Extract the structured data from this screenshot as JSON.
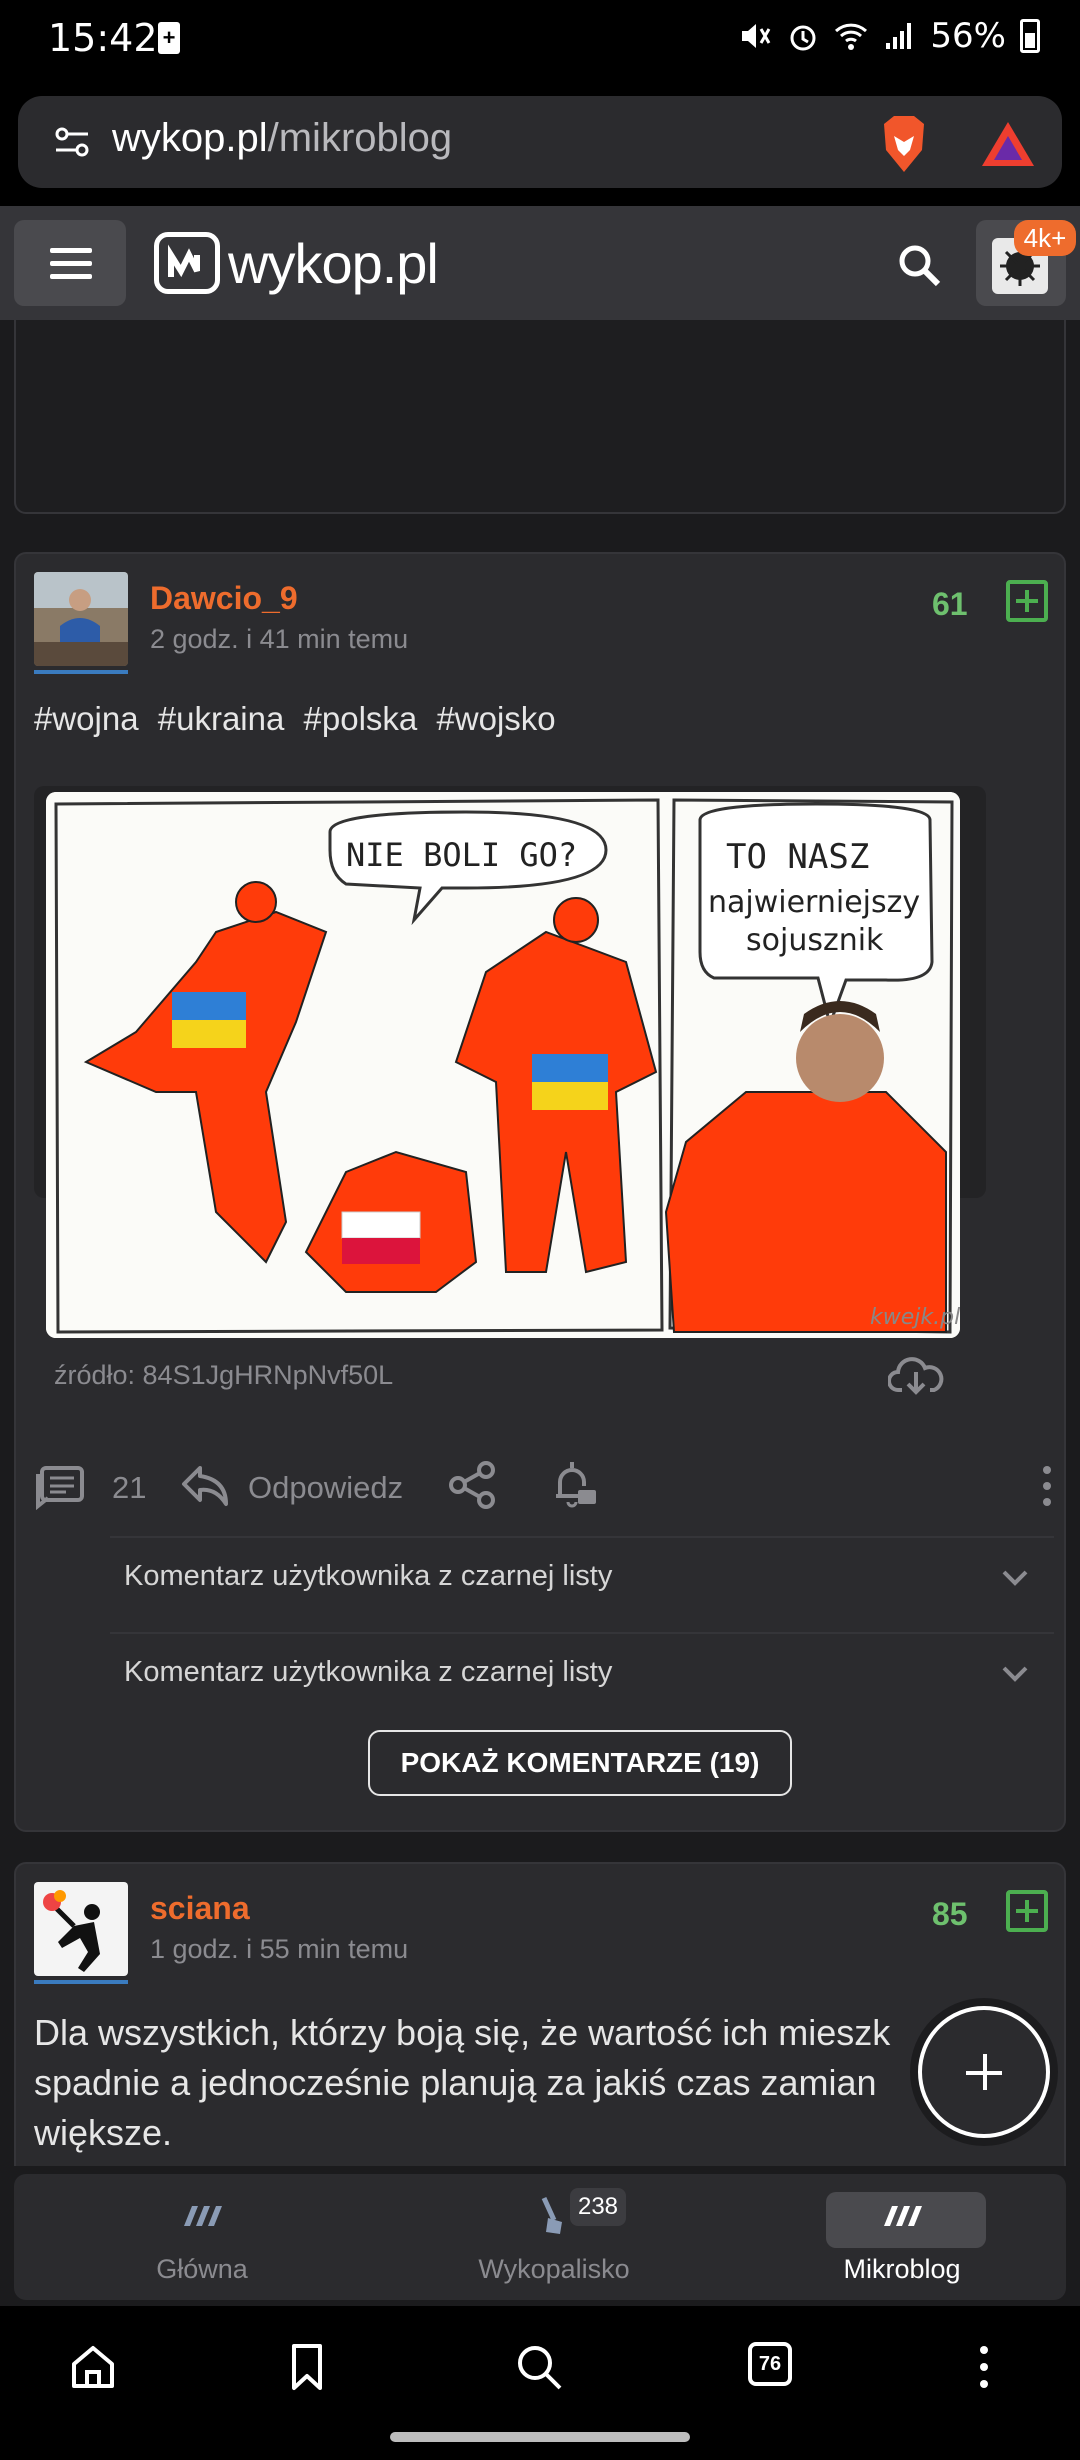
{
  "status_bar": {
    "time": "15:42",
    "battery": "56%"
  },
  "browser": {
    "url_host": "wykop.pl",
    "url_path": "/mikroblog",
    "tabs_count": "76"
  },
  "header": {
    "logo_text": "wykop.pl",
    "notifications_badge": "4k+"
  },
  "posts": [
    {
      "username": "Dawcio_9",
      "time": "2 godz. i 41 min temu",
      "score": "61",
      "tags": [
        "#wojna",
        "#ukraina",
        "#polska",
        "#wojsko"
      ],
      "meme": {
        "bubble_left": "NIE BOLI GO?",
        "bubble_right_top": "TO NASZ",
        "bubble_right_l2": "najwierniejszy",
        "bubble_right_l3": "sojusznik",
        "watermark": "kwejk.pl"
      },
      "source": "źródło: 84S1JgHRNpNvf50L",
      "comments_count": "21",
      "reply_label": "Odpowiedz",
      "hidden_comments": [
        "Komentarz użytkownika z czarnej listy",
        "Komentarz użytkownika z czarnej listy"
      ],
      "show_comments_label": "POKAŻ KOMENTARZE (19)"
    },
    {
      "username": "sciana",
      "time": "1 godz. i 55 min temu",
      "score": "85",
      "text": "Dla wszystkich, którzy boją się, że wartość ich mieszk spadnie a jednocześnie planują za jakiś czas zamian większe."
    }
  ],
  "site_nav": {
    "items": [
      {
        "label": "Główna"
      },
      {
        "label": "Wykopalisko",
        "badge": "238"
      },
      {
        "label": "Mikroblog",
        "active": true
      }
    ]
  },
  "colors": {
    "accent_orange": "#ee6c2d",
    "vote_green": "#4caf50",
    "card_bg": "#2b2b2e"
  }
}
